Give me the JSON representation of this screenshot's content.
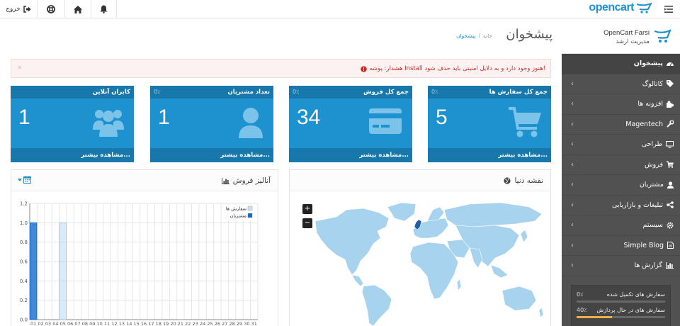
{
  "header": {
    "logo_text": "opencart",
    "logout_label": "خروج"
  },
  "profile": {
    "name": "OpenCart Farsi",
    "role": "مدیریت ارشد"
  },
  "menu": [
    {
      "label": "پیشخوان",
      "icon": "dashboard-icon",
      "active": true
    },
    {
      "label": "کاتالوگ",
      "icon": "tags-icon"
    },
    {
      "label": "افزونه ها",
      "icon": "puzzle-icon"
    },
    {
      "label": "Magentech",
      "icon": "wrench-icon"
    },
    {
      "label": "طراحی",
      "icon": "desktop-icon"
    },
    {
      "label": "فروش",
      "icon": "cart-icon"
    },
    {
      "label": "مشتریان",
      "icon": "user-icon"
    },
    {
      "label": "تبلیغات و بازاریابی",
      "icon": "share-icon"
    },
    {
      "label": "سیستم",
      "icon": "cog-icon"
    },
    {
      "label": "Simple Blog",
      "icon": "file-icon"
    },
    {
      "label": "گزارش ها",
      "icon": "bar-chart-icon"
    }
  ],
  "sidebar_stats": [
    {
      "label": "سفارش های تکمیل شده",
      "value": "0٪",
      "fill": 0,
      "color": "#8fbb6c"
    },
    {
      "label": "سفارش های در حال پردازش",
      "value": "40٪",
      "fill": 0.4,
      "color": "#f0ad4e"
    }
  ],
  "page": {
    "title": "پیشخوان",
    "breadcrumb_home": "خانه",
    "breadcrumb_sep": "/",
    "breadcrumb_current": "پیشخوان"
  },
  "alert": {
    "text": "هشدار: پوشه Install هنوز وجود دارد و به دلایل امنیتی باید حذف شود!",
    "close": "×"
  },
  "tiles": [
    {
      "title": "جمع کل سفارش ها",
      "percent": "0٪",
      "value": "5",
      "link": "مشاهده بیشتر...",
      "icon": "shopping-cart-icon"
    },
    {
      "title": "جمع کل فروش",
      "percent": "0٪",
      "value": "34",
      "link": "مشاهده بیشتر...",
      "icon": "credit-card-icon"
    },
    {
      "title": "تعداد مشتریان",
      "percent": "0٪",
      "value": "1",
      "link": "مشاهده بیشتر...",
      "icon": "user-icon"
    },
    {
      "title": "کابران آنلاین",
      "value": "1",
      "link": "مشاهده بیشتر...",
      "icon": "users-icon"
    }
  ],
  "map_panel": {
    "title": "نقشه دنیا",
    "zoom_in": "+",
    "zoom_out": "−",
    "colors": {
      "land": "#a8d3ef",
      "highlight": "#1e5fa8"
    }
  },
  "chart_panel": {
    "title": "آنالیز فروش"
  },
  "chart_data": {
    "type": "bar",
    "categories": [
      "01",
      "02",
      "03",
      "04",
      "05",
      "06",
      "07",
      "08",
      "09",
      "10",
      "11",
      "12",
      "13",
      "14",
      "15",
      "16",
      "17",
      "18",
      "19",
      "20",
      "21",
      "22",
      "23",
      "24",
      "25",
      "26",
      "27",
      "28",
      "29",
      "30",
      "31"
    ],
    "series": [
      {
        "name": "سفارش ها",
        "color": "#9cc2e5",
        "values": [
          1,
          0,
          0,
          0,
          1,
          0,
          0,
          0,
          0,
          0,
          0,
          0,
          0,
          0,
          0,
          0,
          0,
          0,
          0,
          0,
          0,
          0,
          0,
          0,
          0,
          0,
          0,
          0,
          0,
          0,
          0
        ]
      },
      {
        "name": "مشتریان",
        "color": "#1065d2",
        "values": [
          1,
          0,
          0,
          0,
          0,
          0,
          0,
          0,
          0,
          0,
          0,
          0,
          0,
          0,
          0,
          0,
          0,
          0,
          0,
          0,
          0,
          0,
          0,
          0,
          0,
          0,
          0,
          0,
          0,
          0,
          0
        ]
      }
    ],
    "yticks": [
      "0.0",
      "0.2",
      "0.4",
      "0.6",
      "0.8",
      "1.0",
      "1.2"
    ],
    "ylim": [
      0,
      1.2
    ],
    "grid": true,
    "legend": "top-right"
  }
}
